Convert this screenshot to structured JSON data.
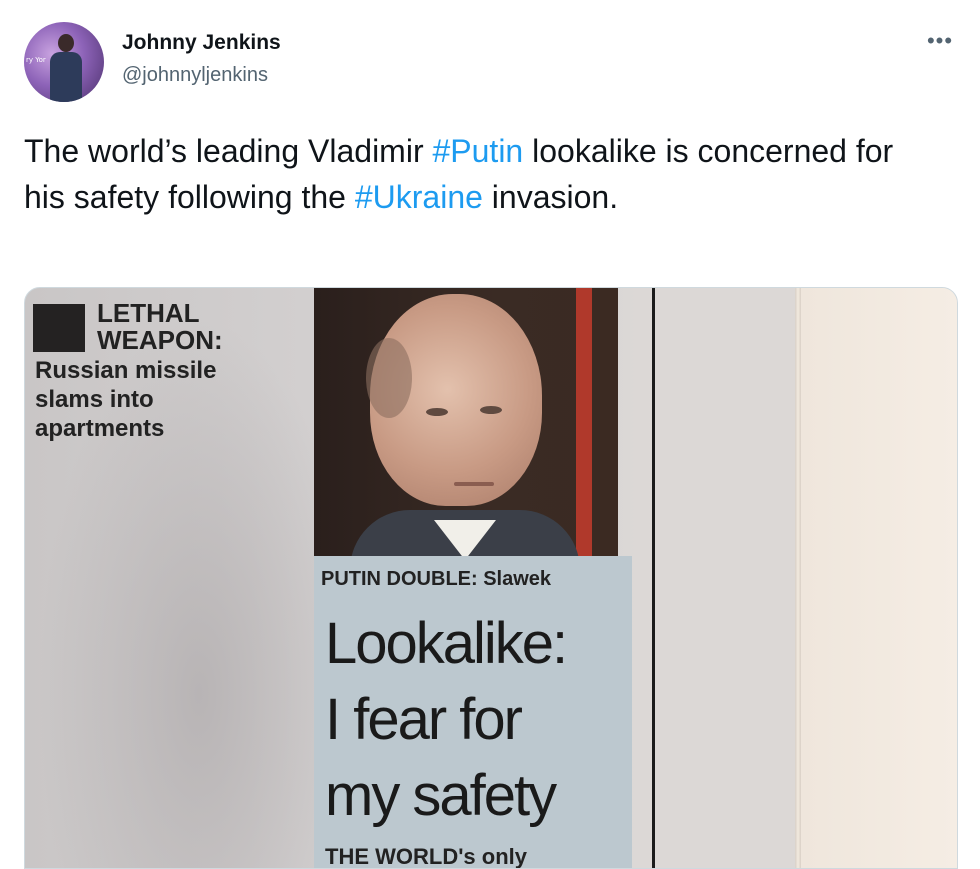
{
  "author": {
    "display_name": "Johnny Jenkins",
    "handle": "@johnnyljenkins",
    "avatar_caption": "ry Yor"
  },
  "actions": {
    "more_label": "•••"
  },
  "tweet": {
    "segments": [
      {
        "text": "The world’s leading Vladimir ",
        "hashtag": false
      },
      {
        "text": "#Putin",
        "hashtag": true
      },
      {
        "text": " lookalike is concerned for his safety following the ",
        "hashtag": false
      },
      {
        "text": "#Ukraine",
        "hashtag": true
      },
      {
        "text": " invasion.",
        "hashtag": false
      }
    ]
  },
  "media": {
    "sidebar_headline_line1": "LETHAL",
    "sidebar_headline_line2": "WEAPON:",
    "sidebar_sub_line1": "Russian missile",
    "sidebar_sub_line2": "slams into",
    "sidebar_sub_line3": "apartments",
    "photo_caption": "PUTIN DOUBLE: Slawek",
    "headline_line1": "Lookalike:",
    "headline_line2": "I fear for",
    "headline_line3": "my safety",
    "cut_off_text": "THE WORLD's only"
  },
  "colors": {
    "text": "#0f1419",
    "secondary": "#536471",
    "link": "#1d9bf0"
  }
}
